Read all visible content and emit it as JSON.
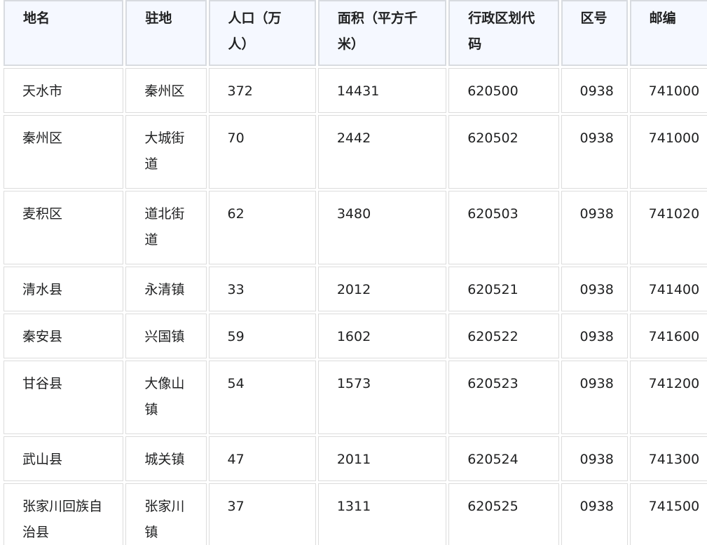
{
  "table": {
    "headers": [
      "地名",
      "驻地",
      "人口（万人）",
      "面积（平方千米）",
      "行政区划代码",
      "区号",
      "邮编"
    ],
    "rows": [
      [
        "天水市",
        "秦州区",
        "372",
        "14431",
        "620500",
        "0938",
        "741000"
      ],
      [
        "秦州区",
        "大城街道",
        "70",
        "2442",
        "620502",
        "0938",
        "741000"
      ],
      [
        "麦积区",
        "道北街道",
        "62",
        "3480",
        "620503",
        "0938",
        "741020"
      ],
      [
        "清水县",
        "永清镇",
        "33",
        "2012",
        "620521",
        "0938",
        "741400"
      ],
      [
        "秦安县",
        "兴国镇",
        "59",
        "1602",
        "620522",
        "0938",
        "741600"
      ],
      [
        "甘谷县",
        "大像山镇",
        "54",
        "1573",
        "620523",
        "0938",
        "741200"
      ],
      [
        "武山县",
        "城关镇",
        "47",
        "2011",
        "620524",
        "0938",
        "741300"
      ],
      [
        "张家川回族自治县",
        "张家川镇",
        "37",
        "1311",
        "620525",
        "0938",
        "741500"
      ]
    ]
  }
}
